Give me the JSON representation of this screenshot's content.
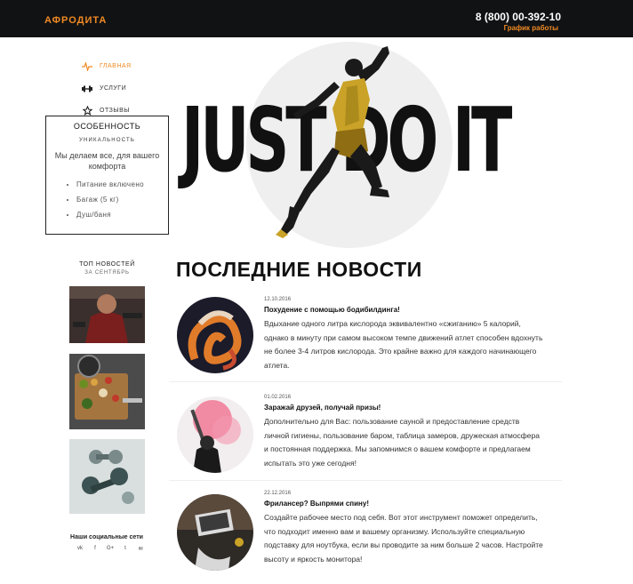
{
  "header": {
    "logo": "АФРОДИТА",
    "phone": "8 (800) 00-392-10",
    "schedule_link": "График работы"
  },
  "nav": {
    "items": [
      {
        "label": "Главная",
        "icon": "pulse-icon",
        "active": true
      },
      {
        "label": "Услуги",
        "icon": "dumbbell-icon",
        "active": false
      },
      {
        "label": "Отзывы",
        "icon": "star-icon",
        "active": false
      }
    ]
  },
  "features": {
    "title": "ОСОБЕННОСТЬ",
    "subtitle": "УНИКАЛЬНОСТЬ",
    "description": "Мы делаем все, для вашего комфорта",
    "items": [
      "Питание включено",
      "Багаж (5 кг)",
      "Душ/баня"
    ]
  },
  "hero": {
    "slogan": "JUST DO IT"
  },
  "top_news": {
    "title": "Топ новостей",
    "subtitle": "за сентябрь"
  },
  "social": {
    "title": "Наши социальные сети",
    "icons": [
      "vk-icon",
      "facebook-icon",
      "google-plus-icon",
      "twitter-icon",
      "mail-icon"
    ],
    "glyphs": [
      "vk",
      "f",
      "G+",
      "t",
      "✉"
    ]
  },
  "news": {
    "heading": "ПОСЛЕДНИЕ НОВОСТИ",
    "items": [
      {
        "date": "12.10.2016",
        "title": "Похудение с помощью бодибилдинга!",
        "text": "Вдыхание одного литра кислорода эквивалентно «сжиганию» 5 калорий, однако в минуту при самом высоком темпе движений атлет способен вдохнуть не более 3-4 литров кислорода. Это крайне важно для каждого начинающего атлета."
      },
      {
        "date": "01.02.2016",
        "title": "Заражай друзей, получай призы!",
        "text": "Дополнительно для Вас: пользование сауной и предоставление средств личной гигиены, пользование баром, таблица замеров, дружеская атмосфера и постоянная поддержка. Мы запомнимся о вашем комфорте и предлагаем испытать это уже сегодня!"
      },
      {
        "date": "22.12.2016",
        "title": "Фрилансер? Выпрями спину!",
        "text": "Создайте рабочее место под себя. Вот этот инструмент поможет определить, что подходит именно вам и вашему организму. Используйте специальную подставку для ноутбука, если вы проводите за ним больше 2 часов. Настройте высоту и яркость монитора!"
      }
    ]
  }
}
